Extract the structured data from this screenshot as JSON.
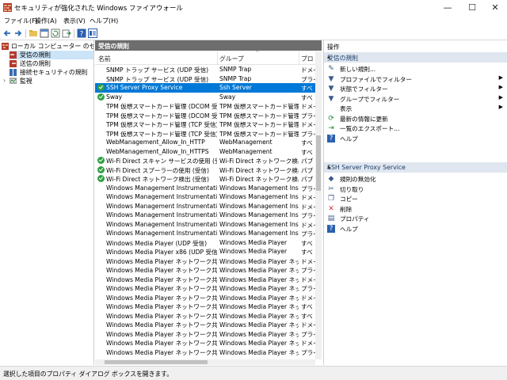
{
  "window": {
    "title": "セキュリティが強化された Windows ファイアウォール",
    "minimize": "—",
    "maximize": "☐",
    "close": "✕"
  },
  "menu": [
    "ファイル(F)",
    "操作(A)",
    "表示(V)",
    "ヘルプ(H)"
  ],
  "toolbar": [
    "back-arrow-icon",
    "forward-arrow-icon",
    "folder-up-icon",
    "properties-icon",
    "refresh-icon",
    "export-icon",
    "help-icon",
    "mmc-icon"
  ],
  "tree": {
    "root": "ローカル コンピューター のセキュリティ",
    "items": [
      "受信の規則",
      "送信の規則",
      "接続セキュリティの規則",
      "監視"
    ]
  },
  "center": {
    "header": "受信の規則",
    "columns": [
      "名前",
      "グループ",
      "プロ"
    ],
    "rows": [
      {
        "name": "SNMP トラップ サービス (UDP 受信)",
        "group": "SNMP Trap",
        "profile": "ドメイ",
        "enabled": false,
        "selected": false
      },
      {
        "name": "SNMP トラップ サービス (UDP 受信)",
        "group": "SNMP Trap",
        "profile": "プライ",
        "enabled": false,
        "selected": false
      },
      {
        "name": "SSH Server Proxy Service",
        "group": "Ssh Server",
        "profile": "すべ",
        "enabled": true,
        "selected": true
      },
      {
        "name": "Sway",
        "group": "Sway",
        "profile": "すべ",
        "enabled": true,
        "selected": false
      },
      {
        "name": "TPM 仮想スマートカード管理 (DCOM 受信)",
        "group": "TPM 仮想スマートカード管理",
        "profile": "ドメイ",
        "enabled": false,
        "selected": false
      },
      {
        "name": "TPM 仮想スマートカード管理 (DCOM 受信)",
        "group": "TPM 仮想スマートカード管理",
        "profile": "プライ",
        "enabled": false,
        "selected": false
      },
      {
        "name": "TPM 仮想スマートカード管理 (TCP 受信)",
        "group": "TPM 仮想スマートカード管理",
        "profile": "ドメイ",
        "enabled": false,
        "selected": false
      },
      {
        "name": "TPM 仮想スマートカード管理 (TCP 受信)",
        "group": "TPM 仮想スマートカード管理",
        "profile": "プライ",
        "enabled": false,
        "selected": false
      },
      {
        "name": "WebManagement_Allow_In_HTTP",
        "group": "WebManagement",
        "profile": "すべ",
        "enabled": false,
        "selected": false
      },
      {
        "name": "WebManagement_Allow_In_HTTPS",
        "group": "WebManagement",
        "profile": "すべ",
        "enabled": false,
        "selected": false
      },
      {
        "name": "Wi-Fi Direct スキャン サービスの使用 (受信)",
        "group": "Wi-Fi Direct ネットワーク検出",
        "profile": "パブ",
        "enabled": true,
        "selected": false
      },
      {
        "name": "Wi-Fi Direct スプーラーの使用 (受信)",
        "group": "Wi-Fi Direct ネットワーク検出",
        "profile": "パブ",
        "enabled": true,
        "selected": false
      },
      {
        "name": "Wi-Fi Direct ネットワーク検出 (受信)",
        "group": "Wi-Fi Direct ネットワーク検出",
        "profile": "パブ",
        "enabled": true,
        "selected": false
      },
      {
        "name": "Windows Management Instrumentation (...",
        "group": "Windows Management Inst...",
        "profile": "プライ",
        "enabled": false,
        "selected": false
      },
      {
        "name": "Windows Management Instrumentation (...",
        "group": "Windows Management Inst...",
        "profile": "ドメイ",
        "enabled": false,
        "selected": false
      },
      {
        "name": "Windows Management Instrumentation (...",
        "group": "Windows Management Inst...",
        "profile": "ドメイ",
        "enabled": false,
        "selected": false
      },
      {
        "name": "Windows Management Instrumentation (...",
        "group": "Windows Management Inst...",
        "profile": "プライ",
        "enabled": false,
        "selected": false
      },
      {
        "name": "Windows Management Instrumentation (...",
        "group": "Windows Management Inst...",
        "profile": "ドメイ",
        "enabled": false,
        "selected": false
      },
      {
        "name": "Windows Management Instrumentation (...",
        "group": "Windows Management Inst...",
        "profile": "プライ",
        "enabled": false,
        "selected": false
      },
      {
        "name": "Windows Media Player (UDP 受信)",
        "group": "Windows Media Player",
        "profile": "すべ",
        "enabled": false,
        "selected": false
      },
      {
        "name": "Windows Media Player x86 (UDP 受信)",
        "group": "Windows Media Player",
        "profile": "すべ",
        "enabled": false,
        "selected": false
      },
      {
        "name": "Windows Media Player ネットワーク共有サ...",
        "group": "Windows Media Player ネット...",
        "profile": "ドメイ",
        "enabled": false,
        "selected": false
      },
      {
        "name": "Windows Media Player ネットワーク共有サ...",
        "group": "Windows Media Player ネット...",
        "profile": "プライ",
        "enabled": false,
        "selected": false
      },
      {
        "name": "Windows Media Player ネットワーク共有サ...",
        "group": "Windows Media Player ネット...",
        "profile": "ドメイ",
        "enabled": false,
        "selected": false
      },
      {
        "name": "Windows Media Player ネットワーク共有サ...",
        "group": "Windows Media Player ネット...",
        "profile": "プライ",
        "enabled": false,
        "selected": false
      },
      {
        "name": "Windows Media Player ネットワーク共有サ...",
        "group": "Windows Media Player ネット...",
        "profile": "ドメイ",
        "enabled": false,
        "selected": false
      },
      {
        "name": "Windows Media Player ネットワーク共有サ...",
        "group": "Windows Media Player ネット...",
        "profile": "すべ",
        "enabled": false,
        "selected": false
      },
      {
        "name": "Windows Media Player ネットワーク共有サ...",
        "group": "Windows Media Player ネット...",
        "profile": "すべ",
        "enabled": false,
        "selected": false
      },
      {
        "name": "Windows Media Player ネットワーク共有サ...",
        "group": "Windows Media Player ネット...",
        "profile": "ドメイ",
        "enabled": false,
        "selected": false
      },
      {
        "name": "Windows Media Player ネットワーク共有サ...",
        "group": "Windows Media Player ネット...",
        "profile": "プライ",
        "enabled": false,
        "selected": false
      },
      {
        "name": "Windows Media Player ネットワーク共有サ...",
        "group": "Windows Media Player ネット...",
        "profile": "ドメイ",
        "enabled": false,
        "selected": false
      },
      {
        "name": "Windows Media Player ネットワーク共有サ...",
        "group": "Windows Media Player ネット...",
        "profile": "プライ",
        "enabled": false,
        "selected": false
      }
    ]
  },
  "actions": {
    "title": "操作",
    "section1": {
      "title": "受信の規則",
      "items": [
        {
          "icon": "new-rule-icon",
          "glyph": "✎",
          "label": "新しい規則...",
          "submenu": false
        },
        {
          "icon": "filter-icon",
          "glyph": "▼",
          "label": "プロファイルでフィルター",
          "submenu": true
        },
        {
          "icon": "filter-icon",
          "glyph": "▼",
          "label": "状態でフィルター",
          "submenu": true
        },
        {
          "icon": "filter-icon",
          "glyph": "▼",
          "label": "グループでフィルター",
          "submenu": true
        },
        {
          "icon": "view-icon",
          "glyph": "",
          "label": "表示",
          "submenu": true
        },
        {
          "icon": "refresh-icon",
          "glyph": "⟳",
          "label": "最新の情報に更新",
          "submenu": false
        },
        {
          "icon": "export-icon",
          "glyph": "⇥",
          "label": "一覧のエクスポート...",
          "submenu": false
        },
        {
          "icon": "help-icon",
          "glyph": "?",
          "label": "ヘルプ",
          "submenu": false
        }
      ]
    },
    "section2": {
      "title": "SSH Server Proxy Service",
      "items": [
        {
          "icon": "disable-rule-icon",
          "glyph": "◆",
          "label": "規則の無効化",
          "submenu": false
        },
        {
          "icon": "cut-icon",
          "glyph": "✂",
          "label": "切り取り",
          "submenu": false
        },
        {
          "icon": "copy-icon",
          "glyph": "❐",
          "label": "コピー",
          "submenu": false
        },
        {
          "icon": "delete-icon",
          "glyph": "✕",
          "label": "削除",
          "submenu": false
        },
        {
          "icon": "properties-icon",
          "glyph": "▤",
          "label": "プロパティ",
          "submenu": false
        },
        {
          "icon": "help-icon",
          "glyph": "?",
          "label": "ヘルプ",
          "submenu": false
        }
      ]
    }
  },
  "status": "選択した項目のプロパティ ダイアログ ボックスを開きます。",
  "colors": {
    "selected": "#0078d7",
    "header": "#6d6d6d",
    "section": "#dfe6ef",
    "enabled": "#2ea043",
    "delete": "#d13438"
  }
}
